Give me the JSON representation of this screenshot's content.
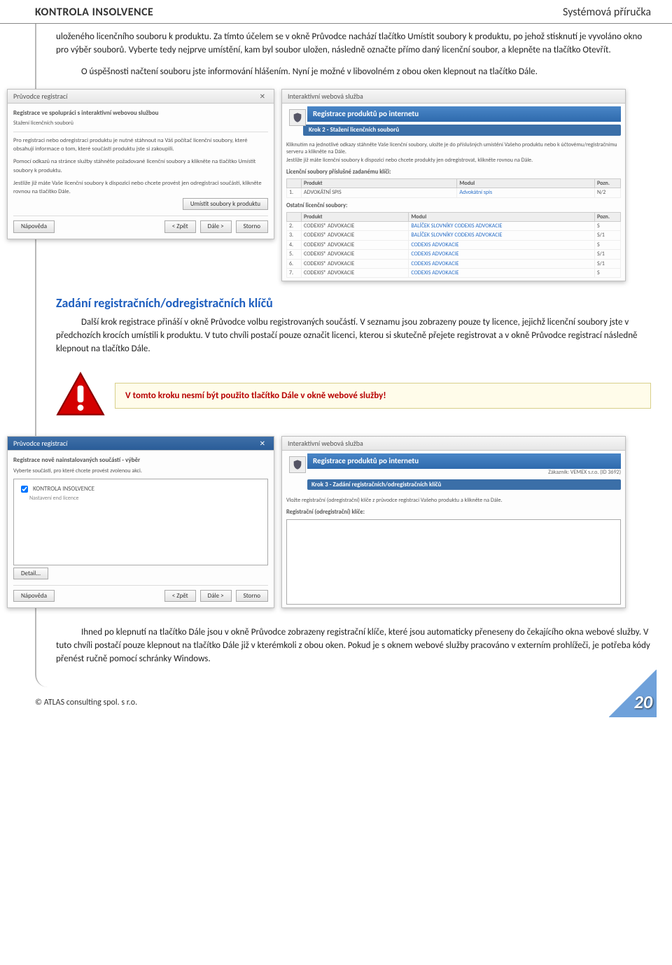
{
  "header": {
    "left": "KONTROLA INSOLVENCE",
    "right": "Systémová příručka"
  },
  "p1": "uloženého licenčního souboru k produktu. Za tímto účelem se v okně Průvodce nachází tlačítko Umístit soubory k produktu, po jehož stisknutí je vyvoláno okno pro výběr souborů. Vyberte tedy nejprve umístění, kam byl soubor uložen, následně označte přímo daný licenční soubor, a klepněte na tlačítko Otevřít.",
  "p2": "O úspěšnosti načtení souboru jste informování hlášením. Nyní je možné v libovolném z obou oken klepnout na tlačítko Dále.",
  "h2a": "Zadání registračních/odregistračních klíčů",
  "p3": "Další krok registrace přináší v okně Průvodce volbu registrovaných součástí. V seznamu jsou zobrazeny pouze ty licence, jejichž licenční soubory jste v předchozích krocích umístili k produktu. V tuto chvíli postačí pouze označit licenci, kterou si skutečně přejete registrovat a v okně Průvodce registrací následně klepnout na tlačítko Dále.",
  "warn": "V tomto kroku nesmí být použito tlačítko Dále v okně webové služby!",
  "p4": "Ihned po klepnutí na tlačítko Dále jsou v okně Průvodce zobrazeny registrační klíče, které jsou automaticky přeneseny do čekajícího okna webové služby. V tuto chvíli postačí pouze klepnout na tlačítko Dále již v kterémkoli z obou oken. Pokud je s oknem webové služby pracováno v externím prohlížeči, je potřeba kódy přenést ručně pomocí schránky Windows.",
  "footer": "© ATLAS consulting spol. s r.o.",
  "pagenum": "20",
  "fig1": {
    "left": {
      "title": "Průvodce registrací",
      "sub": "Registrace ve spolupráci s interaktivní webovou službou",
      "sub2": "Stažení licenčních souborů",
      "t1": "Pro registraci nebo odregistraci produktu je nutné stáhnout na Váš počítač licenční soubory, které obsahují informace o tom, které součásti produktu jste si zakoupili.",
      "t2": "Pomocí odkazů na stránce služby stáhněte požadované licenční soubory a klikněte na tlačítko Umístit soubory k produktu.",
      "t3": "Jestliže již máte Vaše licenční soubory k dispozici nebo chcete provést jen odregistraci součásti, klikněte rovnou na tlačítko Dále.",
      "btn_place": "Umístit soubory k produktu",
      "btn_help": "Nápověda",
      "btn_back": "< Zpět",
      "btn_next": "Dále >",
      "btn_cancel": "Storno"
    },
    "right": {
      "title": "Interaktivní webová služba",
      "h": "Registrace produktů po internetu",
      "krok": "Krok 2 - Stažení licenčních souborů",
      "txt1": "Kliknutím na jednotlivé odkazy stáhněte Vaše licenční soubory, uložte je do příslušných umístění Vašeho produktu nebo k účtovému/registračnímu serveru a klikněte na Dále.",
      "txt2": "Jestliže již máte licenční soubory k dispozici nebo chcete produkty jen odregistrovat, klikněte rovnou na Dále.",
      "cap1": "Licenční soubory příslušné zadanému klíči:",
      "cap2": "Ostatní licenční soubory:",
      "th": {
        "prod": "Produkt",
        "mod": "Modul",
        "pozn": "Pozn."
      },
      "row0": {
        "n": "1.",
        "p": "ADVOKÁTNÍ SPIS",
        "m": "Advokátní spis",
        "z": "N/2"
      },
      "rows": [
        {
          "n": "2.",
          "p": "CODEXIS® ADVOKACIE",
          "m": "BALÍČEK SLOVNÍKY CODEXIS ADVOKACIE",
          "z": "S"
        },
        {
          "n": "3.",
          "p": "CODEXIS® ADVOKACIE",
          "m": "BALÍČEK SLOVNÍKY CODEXIS ADVOKACIE",
          "z": "S/1"
        },
        {
          "n": "4.",
          "p": "CODEXIS® ADVOKACIE",
          "m": "CODEXIS ADVOKACIE",
          "z": "S"
        },
        {
          "n": "5.",
          "p": "CODEXIS® ADVOKACIE",
          "m": "CODEXIS ADVOKACIE",
          "z": "S/1"
        },
        {
          "n": "6.",
          "p": "CODEXIS® ADVOKACIE",
          "m": "CODEXIS ADVOKACIE",
          "z": "S/1"
        },
        {
          "n": "7.",
          "p": "CODEXIS® ADVOKACIE",
          "m": "CODEXIS ADVOKACIE",
          "z": "S"
        }
      ]
    }
  },
  "fig2": {
    "left": {
      "title": "Průvodce registrací",
      "sub": "Registrace nově nainstalovaných součástí - výběr",
      "sub2": "Vyberte součásti, pro které chcete provést zvolenou akci.",
      "chk": "KONTROLA INSOLVENCE",
      "chk2": "Nastavení end licence",
      "btn_detail": "Detail...",
      "btn_help": "Nápověda",
      "btn_back": "< Zpět",
      "btn_next": "Dále >",
      "btn_cancel": "Storno"
    },
    "right": {
      "title": "Interaktivní webová služba",
      "h": "Registrace produktů po internetu",
      "zak": "Zákazník: VEMEX s.r.o. (ID 3692)",
      "krok": "Krok 3 - Zadání registračních/odregistračních klíčů",
      "txt": "Vložte registrační (odregistrační) klíče z průvodce registrací Vašeho produktu a klikněte na Dále.",
      "cap": "Registrační (odregistrační) klíče:"
    }
  }
}
